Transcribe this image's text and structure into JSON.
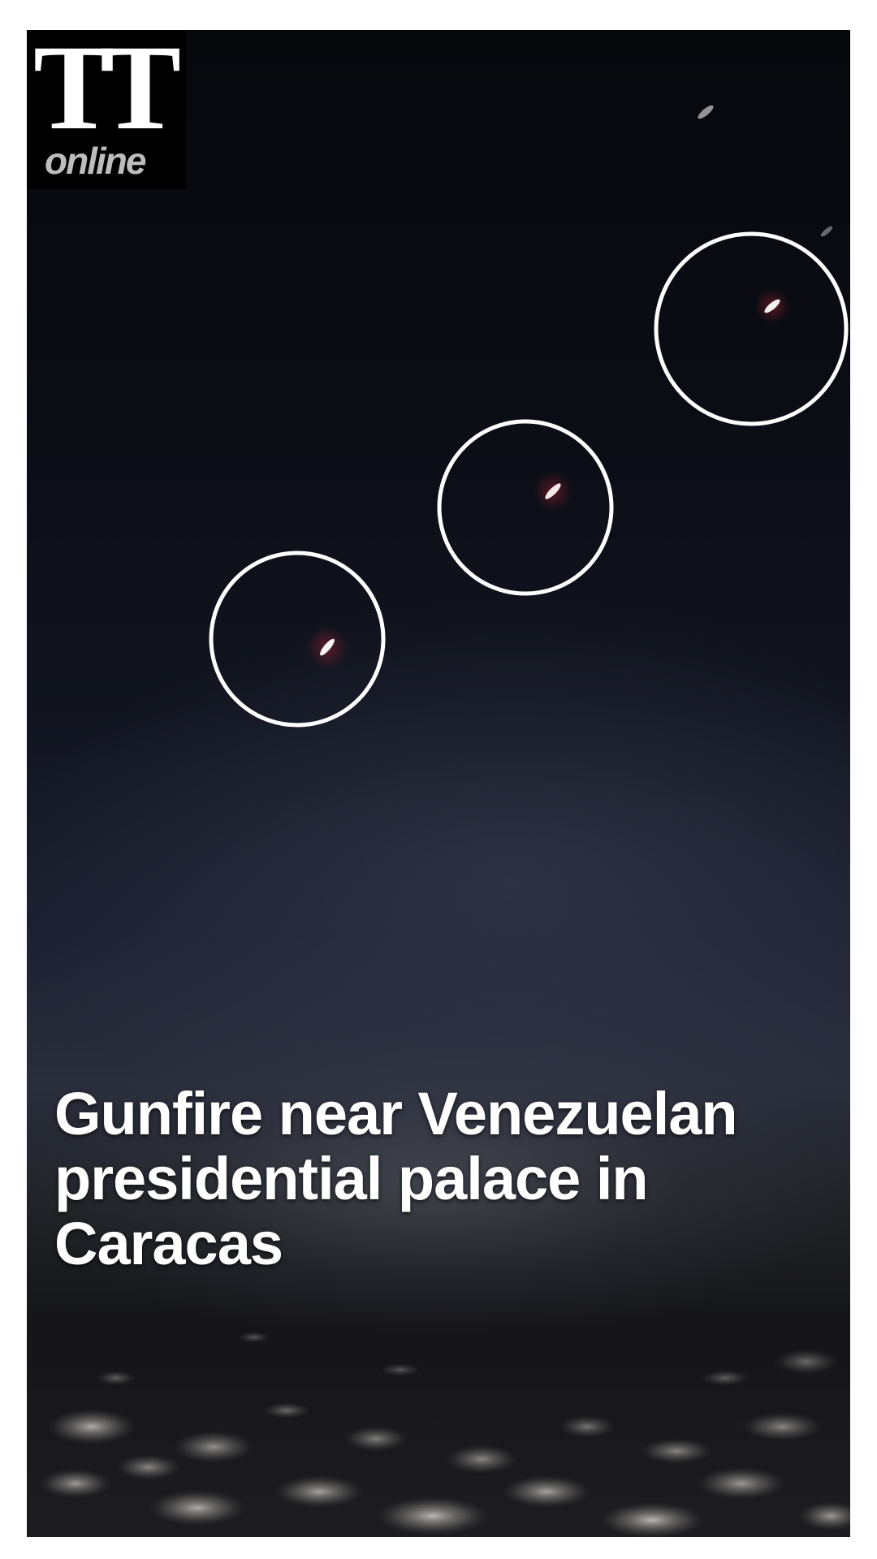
{
  "logo": {
    "mark": "TT",
    "wordmark": "online"
  },
  "headline": "Gunfire near Venezuelan presidential palace in Caracas",
  "colors": {
    "page_border": "#ffffff",
    "sky_top": "#07080c",
    "sky_horizon": "#2a2e3c",
    "circle_stroke": "#ffffff",
    "headline_text": "#ffffff",
    "logo_background": "#000000",
    "logo_wordmark": "#bdbdbd"
  }
}
